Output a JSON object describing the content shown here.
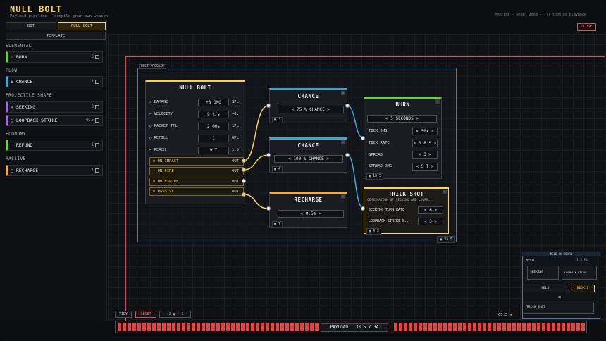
{
  "header": {
    "title": "NULL BOLT",
    "subtitle": "Payload pipeline - compile your own weapon",
    "hint": "MMB pan - wheel zoom - [T] toggles playbook",
    "close_label": "CLOSE"
  },
  "sidebar": {
    "tabs": [
      {
        "label": "BOT",
        "active": false
      },
      {
        "label": "NULL BOLT",
        "active": true
      }
    ],
    "template_label": "TEMPLATE",
    "categories": [
      {
        "name": "ELEMENTAL",
        "items": [
          {
            "icon": "flame-icon",
            "label": "BURN",
            "count": "3",
            "color": "#6fcf3f"
          }
        ]
      },
      {
        "name": "FLOW",
        "items": [
          {
            "icon": "diamond-icon",
            "label": "CHANCE",
            "count": "1",
            "color": "#3fa7d6"
          }
        ]
      },
      {
        "name": "PROJECTILE SHAPE",
        "items": [
          {
            "icon": "target-icon",
            "label": "SEEKING",
            "count": "3",
            "color": "#a56bd6"
          },
          {
            "icon": "ring-icon",
            "label": "LOOPBACK STRIKE",
            "count": "0.5",
            "color": "#a56bd6"
          }
        ]
      },
      {
        "name": "ECONOMY",
        "items": [
          {
            "icon": "square-icon",
            "label": "REFUND",
            "count": "1",
            "color": "#6fcf3f"
          }
        ]
      },
      {
        "name": "PASSIVE",
        "items": [
          {
            "icon": "square-icon",
            "label": "RECHARGE",
            "count": "1",
            "color": "#f4a93e"
          }
        ]
      }
    ]
  },
  "program": {
    "label": "BOLT PROGRAM",
    "cost": "33.5"
  },
  "null_bolt": {
    "title": "NULL BOLT",
    "stats": [
      {
        "icon": "sword-icon",
        "label": "DAMAGE",
        "value": "+3 DMG",
        "side": "3PL"
      },
      {
        "icon": "wave-icon",
        "label": "VELOCITY",
        "value": "9 t/s",
        "side": "+0.."
      },
      {
        "icon": "clock-icon",
        "label": "PACKET TTL",
        "value": "2.00s",
        "side": "1PL"
      },
      {
        "icon": "refill-icon",
        "label": "REFILL",
        "value": "1",
        "side": "0PL"
      },
      {
        "icon": "arrow-icon",
        "label": "REACH",
        "value": "9 T",
        "side": "1.5.."
      }
    ],
    "events": [
      {
        "label": "ON IMPACT",
        "out": "OUT"
      },
      {
        "label": "ON FIRE",
        "out": "OUT"
      },
      {
        "label": "ON EXPIRE",
        "out": "OUT"
      },
      {
        "label": "PASSIVE",
        "out": "OUT"
      }
    ]
  },
  "chance1": {
    "title": "CHANCE",
    "value": "75 % CHANCE",
    "cost": "3"
  },
  "chance2": {
    "title": "CHANCE",
    "value": "100 % CHANCE",
    "cost": "4"
  },
  "recharge": {
    "title": "RECHARGE",
    "value": "0.5s",
    "cost": "7"
  },
  "burn": {
    "title": "BURN",
    "duration": "5 SECONDS",
    "rows": [
      {
        "label": "TICK DMG",
        "value": "50x"
      },
      {
        "label": "TICK RATE",
        "value": "0.8 S"
      },
      {
        "label": "SPREAD",
        "value": "3"
      },
      {
        "label": "SPREAD DMG",
        "value": "5 T"
      }
    ],
    "cost": "10.5"
  },
  "trick": {
    "title": "TRICK SHOT",
    "subtitle": "COMBINATION OF SEEKING AND LOOPB..",
    "rows": [
      {
        "label": "SEEKING TURN RATE",
        "value": "6"
      },
      {
        "label": "LOOPBACK STRIKE B..",
        "value": "3"
      }
    ],
    "cost": "4.2"
  },
  "bottom": {
    "tidy": "TIDY",
    "reset": "RESET",
    "chip1": "+2",
    "chip2": "1",
    "side_value": "65.5",
    "payload_label": "PAYLOAD",
    "payload_value": "33.5 / 34"
  },
  "meld": {
    "title": "MELD ON BOARD",
    "label": "MELD",
    "ratio": "1.2 PL",
    "a": "SEEKING",
    "b": "LOOPBACK STRIKE",
    "meld_label": "MELD",
    "book": "BOOK 1",
    "eq": "=",
    "result": "TRICK SHOT"
  }
}
